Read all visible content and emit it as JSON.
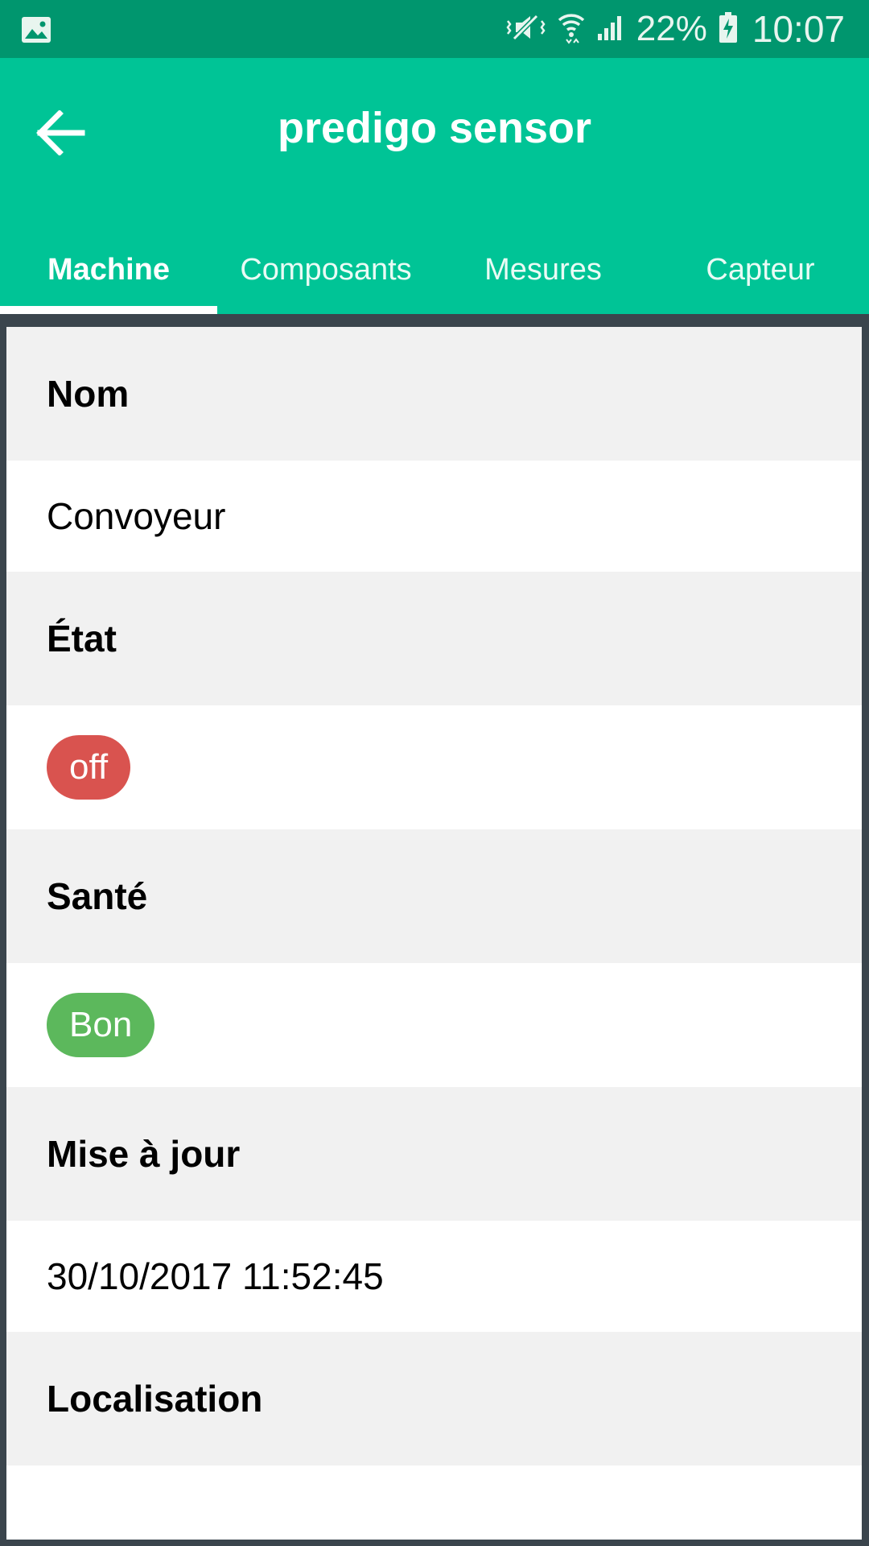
{
  "status_bar": {
    "battery_percent": "22%",
    "time": "10:07",
    "icons": [
      "gallery-icon",
      "mute-vibrate-icon",
      "wifi-icon",
      "signal-icon",
      "battery-charging-icon"
    ]
  },
  "app_bar": {
    "title": "predigo sensor",
    "back_icon": "arrow-left-icon",
    "accent_color": "#00c496"
  },
  "tabs": [
    {
      "label": "Machine",
      "active": true
    },
    {
      "label": "Composants",
      "active": false
    },
    {
      "label": "Mesures",
      "active": false
    },
    {
      "label": "Capteur",
      "active": false
    }
  ],
  "details": {
    "nom_label": "Nom",
    "nom_value": "Convoyeur",
    "etat_label": "État",
    "etat_value": "off",
    "etat_color": "#d9534f",
    "sante_label": "Santé",
    "sante_value": "Bon",
    "sante_color": "#5cb85c",
    "maj_label": "Mise à jour",
    "maj_value": "30/10/2017 11:52:45",
    "localisation_label": "Localisation",
    "localisation_value": ""
  }
}
